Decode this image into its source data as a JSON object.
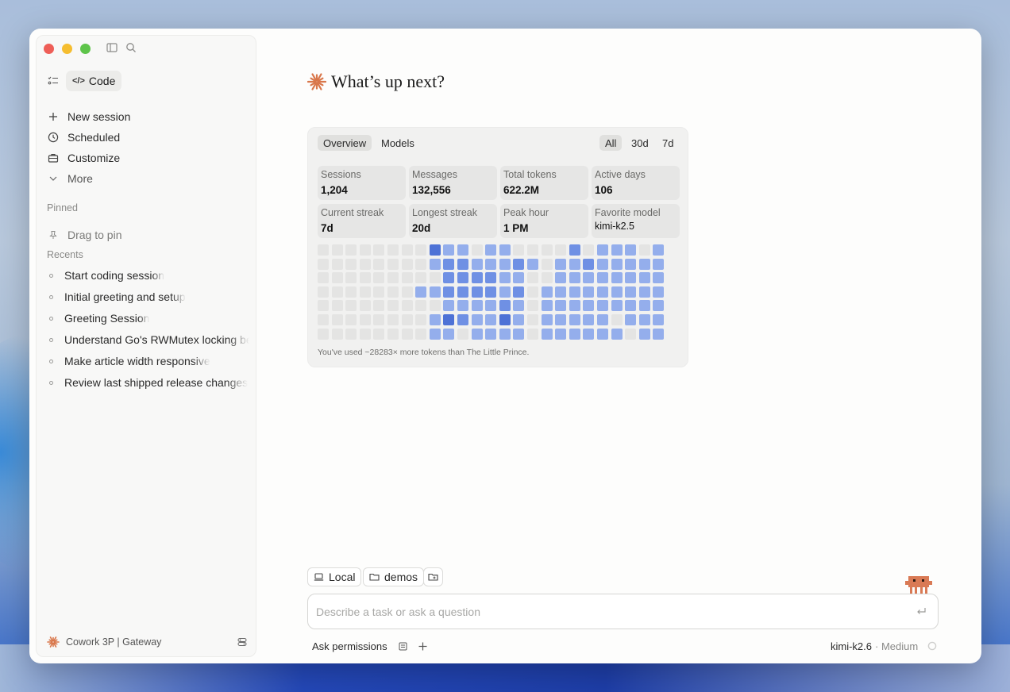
{
  "sidebar": {
    "code_label": "Code",
    "nav": [
      {
        "label": "New session",
        "icon": "plus-icon"
      },
      {
        "label": "Scheduled",
        "icon": "clock-icon"
      },
      {
        "label": "Customize",
        "icon": "briefcase-icon"
      },
      {
        "label": "More",
        "icon": "chevron-down-icon"
      }
    ],
    "pinned_title": "Pinned",
    "pin_hint": "Drag to pin",
    "recents_title": "Recents",
    "recents": [
      "Start coding session",
      "Initial greeting and setup",
      "Greeting Session",
      "Understand Go's RWMutex locking be",
      "Make article width responsive",
      "Review last shipped release changes"
    ],
    "footer_label": "Cowork 3P | Gateway"
  },
  "main": {
    "greeting": "What’s up next?"
  },
  "stats": {
    "tabs": [
      "Overview",
      "Models"
    ],
    "ranges": [
      "All",
      "30d",
      "7d"
    ],
    "cards": [
      {
        "label": "Sessions",
        "value": "1,204"
      },
      {
        "label": "Messages",
        "value": "132,556"
      },
      {
        "label": "Total tokens",
        "value": "622.2M"
      },
      {
        "label": "Active days",
        "value": "106"
      },
      {
        "label": "Current streak",
        "value": "7d"
      },
      {
        "label": "Longest streak",
        "value": "20d"
      },
      {
        "label": "Peak hour",
        "value": "1 PM"
      },
      {
        "label": "Favorite model",
        "value": "kimi-k2.5"
      }
    ],
    "heatmap_levels": [
      [
        0,
        0,
        0,
        0,
        0,
        0,
        0,
        0,
        4,
        2,
        2,
        0,
        2,
        2,
        0,
        0,
        0,
        0,
        3,
        0,
        2,
        2,
        2,
        0,
        2
      ],
      [
        0,
        0,
        0,
        0,
        0,
        0,
        0,
        0,
        2,
        3,
        3,
        2,
        2,
        2,
        3,
        2,
        0,
        2,
        2,
        3,
        2,
        2,
        2,
        2,
        2
      ],
      [
        0,
        0,
        0,
        0,
        0,
        0,
        0,
        0,
        0,
        3,
        3,
        3,
        3,
        2,
        2,
        0,
        0,
        2,
        2,
        2,
        2,
        2,
        2,
        2,
        2
      ],
      [
        0,
        0,
        0,
        0,
        0,
        0,
        0,
        2,
        2,
        3,
        3,
        3,
        3,
        2,
        3,
        0,
        2,
        2,
        2,
        2,
        2,
        2,
        2,
        2,
        2
      ],
      [
        0,
        0,
        0,
        0,
        0,
        0,
        0,
        0,
        0,
        2,
        2,
        2,
        2,
        3,
        2,
        0,
        2,
        2,
        2,
        2,
        2,
        2,
        2,
        2,
        2
      ],
      [
        0,
        0,
        0,
        0,
        0,
        0,
        0,
        0,
        2,
        4,
        3,
        2,
        2,
        4,
        2,
        0,
        2,
        2,
        2,
        2,
        2,
        0,
        2,
        2,
        2
      ],
      [
        0,
        0,
        0,
        0,
        0,
        0,
        0,
        0,
        2,
        2,
        0,
        2,
        2,
        2,
        2,
        0,
        2,
        2,
        2,
        2,
        2,
        2,
        0,
        2,
        2
      ]
    ],
    "heatmap_colors": [
      "#e4e4e3",
      "#c5d3f4",
      "#94aeec",
      "#6f90e4",
      "#4e72d6"
    ],
    "footnote": "You've used ~28283× more tokens than The Little Prince."
  },
  "composer": {
    "chips": [
      {
        "label": "Local",
        "icon": "laptop-icon"
      },
      {
        "label": "demos",
        "icon": "folder-icon"
      }
    ],
    "placeholder": "Describe a task or ask a question",
    "permissions_label": "Ask permissions",
    "model_name": "kimi-k2.6",
    "effort_label": "· Medium"
  },
  "colors": {
    "accent_burst": "#d9774b",
    "mascot": "#d97a55"
  }
}
